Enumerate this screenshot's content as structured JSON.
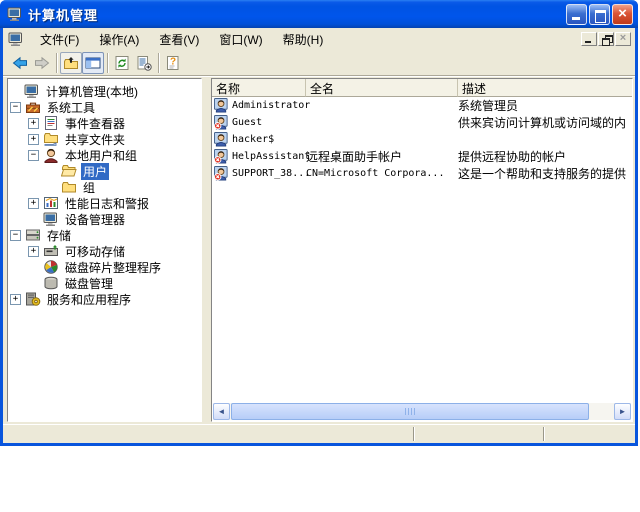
{
  "window": {
    "title": "计算机管理",
    "titlebar_icons": [
      "computer-icon",
      "minimize-button",
      "maximize-button",
      "close-button"
    ]
  },
  "menu": {
    "items": [
      {
        "label": "文件(F)"
      },
      {
        "label": "操作(A)"
      },
      {
        "label": "查看(V)"
      },
      {
        "label": "窗口(W)"
      },
      {
        "label": "帮助(H)"
      }
    ],
    "mdi_buttons": [
      "mdi-minimize",
      "mdi-restore",
      "mdi-close"
    ]
  },
  "toolbar": {
    "icons": [
      "back",
      "forward",
      "up-one-level",
      "show-hide-console-tree",
      "refresh",
      "export-list",
      "help"
    ]
  },
  "tree": {
    "items": [
      {
        "label": "计算机管理(本地)",
        "icon": "computer",
        "level": 0,
        "expander": null,
        "selected": false
      },
      {
        "label": "系统工具",
        "icon": "system-tools",
        "level": 1,
        "expander": "minus",
        "selected": false
      },
      {
        "label": "事件查看器",
        "icon": "event-viewer",
        "level": 2,
        "expander": "plus",
        "selected": false
      },
      {
        "label": "共享文件夹",
        "icon": "shared-folders",
        "level": 2,
        "expander": "plus",
        "selected": false
      },
      {
        "label": "本地用户和组",
        "icon": "local-users-and-groups",
        "level": 2,
        "expander": "minus",
        "selected": false
      },
      {
        "label": "用户",
        "icon": "folder-open",
        "level": 3,
        "expander": null,
        "selected": true
      },
      {
        "label": "组",
        "icon": "folder",
        "level": 3,
        "expander": null,
        "selected": false
      },
      {
        "label": "性能日志和警报",
        "icon": "performance-logs",
        "level": 2,
        "expander": "plus",
        "selected": false
      },
      {
        "label": "设备管理器",
        "icon": "device-manager",
        "level": 2,
        "expander": null,
        "selected": false
      },
      {
        "label": "存储",
        "icon": "storage",
        "level": 1,
        "expander": "minus",
        "selected": false
      },
      {
        "label": "可移动存储",
        "icon": "removable-storage",
        "level": 2,
        "expander": "plus",
        "selected": false
      },
      {
        "label": "磁盘碎片整理程序",
        "icon": "disk-defragmenter",
        "level": 2,
        "expander": null,
        "selected": false
      },
      {
        "label": "磁盘管理",
        "icon": "disk-management",
        "level": 2,
        "expander": null,
        "selected": false
      },
      {
        "label": "服务和应用程序",
        "icon": "services-and-applications",
        "level": 1,
        "expander": "plus",
        "selected": false
      }
    ]
  },
  "list": {
    "columns": [
      {
        "label": "名称"
      },
      {
        "label": "全名"
      },
      {
        "label": "描述"
      }
    ],
    "rows": [
      {
        "name": "Administrator",
        "full_name": "",
        "description": "系统管理员",
        "disabled": false
      },
      {
        "name": "Guest",
        "full_name": "",
        "description": "供来宾访问计算机或访问域的内",
        "disabled": true
      },
      {
        "name": "hacker$",
        "full_name": "",
        "description": "",
        "disabled": false
      },
      {
        "name": "HelpAssistant",
        "full_name": "远程桌面助手帐户",
        "description": "提供远程协助的帐户",
        "disabled": true
      },
      {
        "name": "SUPPORT_38...",
        "full_name": "CN=Microsoft Corpora...",
        "description": "这是一个帮助和支持服务的提供",
        "disabled": true
      }
    ]
  },
  "colors": {
    "titlebar_blue": "#0054E3",
    "window_border": "#0855DD",
    "face": "#ECE9D8",
    "selection_blue": "#316AC5",
    "disabled_badge_red": "#DD2211"
  }
}
